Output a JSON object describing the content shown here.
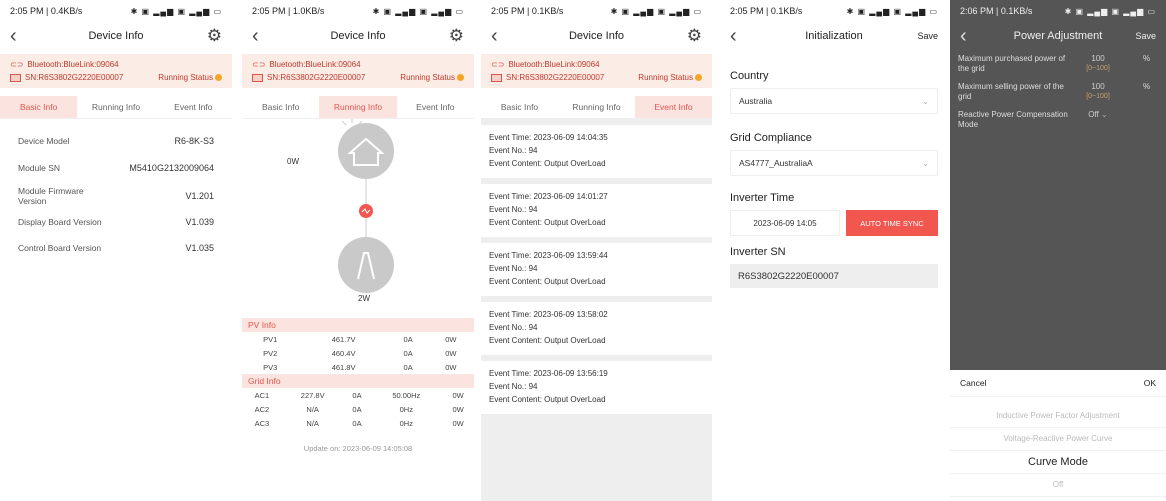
{
  "screen1": {
    "status_time": "2:05 PM | 0.4KB/s",
    "status_icons": "✱ ▣ ▂▄▆ ▣ ▂▄▆ ▭",
    "title": "Device Info",
    "bluetooth": "Bluetooth:BlueLink:09064",
    "sn": "SN:R6S3802G2220E00007",
    "running_status": "Running Status",
    "tabs": [
      "Basic Info",
      "Running Info",
      "Event Info"
    ],
    "rows": [
      {
        "k": "Device Model",
        "v": "R6-8K-S3"
      },
      {
        "k": "Module SN",
        "v": "M5410G2132009064"
      },
      {
        "k": "Module Firmware Version",
        "v": "V1.201"
      },
      {
        "k": "Display Board Version",
        "v": "V1.039"
      },
      {
        "k": "Control Board Version",
        "v": "V1.035"
      }
    ]
  },
  "screen2": {
    "status_time": "2:05 PM | 1.0KB/s",
    "status_icons": "✱ ▣ ▂▄▆ ▣ ▂▄▆ ▭",
    "title": "Device Info",
    "bluetooth": "Bluetooth:BlueLink:09064",
    "sn": "SN:R6S3802G2220E00007",
    "running_status": "Running Status",
    "tabs": [
      "Basic Info",
      "Running Info",
      "Event Info"
    ],
    "home_power": "0W",
    "pv_power": "2W",
    "pv_title": "PV Info",
    "pv": [
      [
        "PV1",
        "461.7V",
        "0A",
        "0W"
      ],
      [
        "PV2",
        "460.4V",
        "0A",
        "0W"
      ],
      [
        "PV3",
        "461.8V",
        "0A",
        "0W"
      ]
    ],
    "grid_title": "Grid Info",
    "grid": [
      [
        "AC1",
        "227.8V",
        "0A",
        "50.00Hz",
        "0W"
      ],
      [
        "AC2",
        "N/A",
        "0A",
        "0Hz",
        "0W"
      ],
      [
        "AC3",
        "N/A",
        "0A",
        "0Hz",
        "0W"
      ]
    ],
    "update": "Update on: 2023-06-09 14:05:08"
  },
  "screen3": {
    "status_time": "2:05 PM | 0.1KB/s",
    "status_icons": "✱ ▣ ▂▄▆ ▣ ▂▄▆ ▭",
    "title": "Device Info",
    "bluetooth": "Bluetooth:BlueLink:09064",
    "sn": "SN:R6S3802G2220E00007",
    "running_status": "Running Status",
    "tabs": [
      "Basic Info",
      "Running Info",
      "Event Info"
    ],
    "events": [
      {
        "time": "Event Time:  2023-06-09 14:04:35",
        "no": "Event No.:  94",
        "content": "Event Content:  Output OverLoad"
      },
      {
        "time": "Event Time:  2023-06-09 14:01:27",
        "no": "Event No.:  94",
        "content": "Event Content:  Output OverLoad"
      },
      {
        "time": "Event Time:  2023-06-09 13:59:44",
        "no": "Event No.:  94",
        "content": "Event Content:  Output OverLoad"
      },
      {
        "time": "Event Time:  2023-06-09 13:58:02",
        "no": "Event No.:  94",
        "content": "Event Content:  Output OverLoad"
      },
      {
        "time": "Event Time:  2023-06-09 13:56:19",
        "no": "Event No.:  94",
        "content": "Event Content:  Output OverLoad"
      }
    ]
  },
  "screen4": {
    "status_time": "2:05 PM | 0.1KB/s",
    "status_icons": "✱ ▣ ▂▄▆ ▣ ▂▄▆ ▭",
    "title": "Initialization",
    "save": "Save",
    "country_label": "Country",
    "country_value": "Australia",
    "grid_label": "Grid Compliance",
    "grid_value": "AS4777_AustraliaA",
    "time_label": "Inverter Time",
    "time_value": "2023-06-09 14:05",
    "sync_button": "AUTO TIME SYNC",
    "sn_label": "Inverter SN",
    "sn_value": "R6S3802G2220E00007"
  },
  "screen5": {
    "status_time": "2:06 PM | 0.1KB/s",
    "status_icons": "✱ ▣ ▂▄▆ ▣ ▂▄▆ ▭",
    "title": "Power Adjustment",
    "save": "Save",
    "rows": [
      {
        "k": "Maximum purchased power of the grid",
        "v": "100",
        "range": "[0~100]",
        "unit": "%"
      },
      {
        "k": "Maximum selling power of the grid",
        "v": "100",
        "range": "[0~100]",
        "unit": "%"
      }
    ],
    "reactive_label": "Reactive Power Compensation Mode",
    "reactive_value": "Off",
    "cancel": "Cancel",
    "ok": "OK",
    "options": [
      "Inductive Power Factor Adjustment",
      "Voltage-Reactive Power Curve",
      "Curve Mode",
      "Off"
    ]
  }
}
